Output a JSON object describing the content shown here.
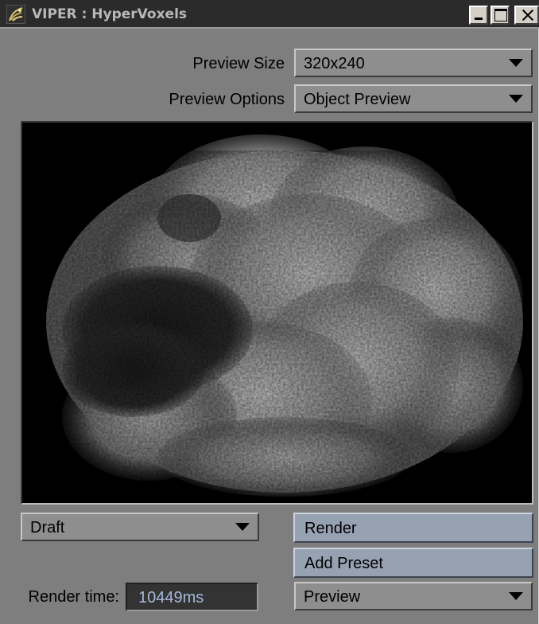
{
  "window": {
    "title": "VIPER : HyperVoxels",
    "controls": {
      "minimize": "minimize",
      "maximize": "maximize",
      "close": "close"
    }
  },
  "preview_size": {
    "label": "Preview Size",
    "value": "320x240"
  },
  "preview_options": {
    "label": "Preview Options",
    "value": "Object Preview"
  },
  "preview_area": {
    "content": "volumetric cloud render"
  },
  "quality": {
    "value": "Draft"
  },
  "buttons": {
    "render": "Render",
    "add_preset": "Add Preset"
  },
  "render_time": {
    "label": "Render time:",
    "value": "10449ms"
  },
  "mode": {
    "value": "Preview"
  },
  "colors": {
    "panel": "#7e7e7e",
    "titlebar": "#2b2b2b",
    "button": "#96a1b1",
    "render_time_text": "#a7b9d9"
  },
  "icons": [
    "viper-app-icon",
    "minimize-icon",
    "maximize-icon",
    "close-icon",
    "chevron-down-icon"
  ]
}
